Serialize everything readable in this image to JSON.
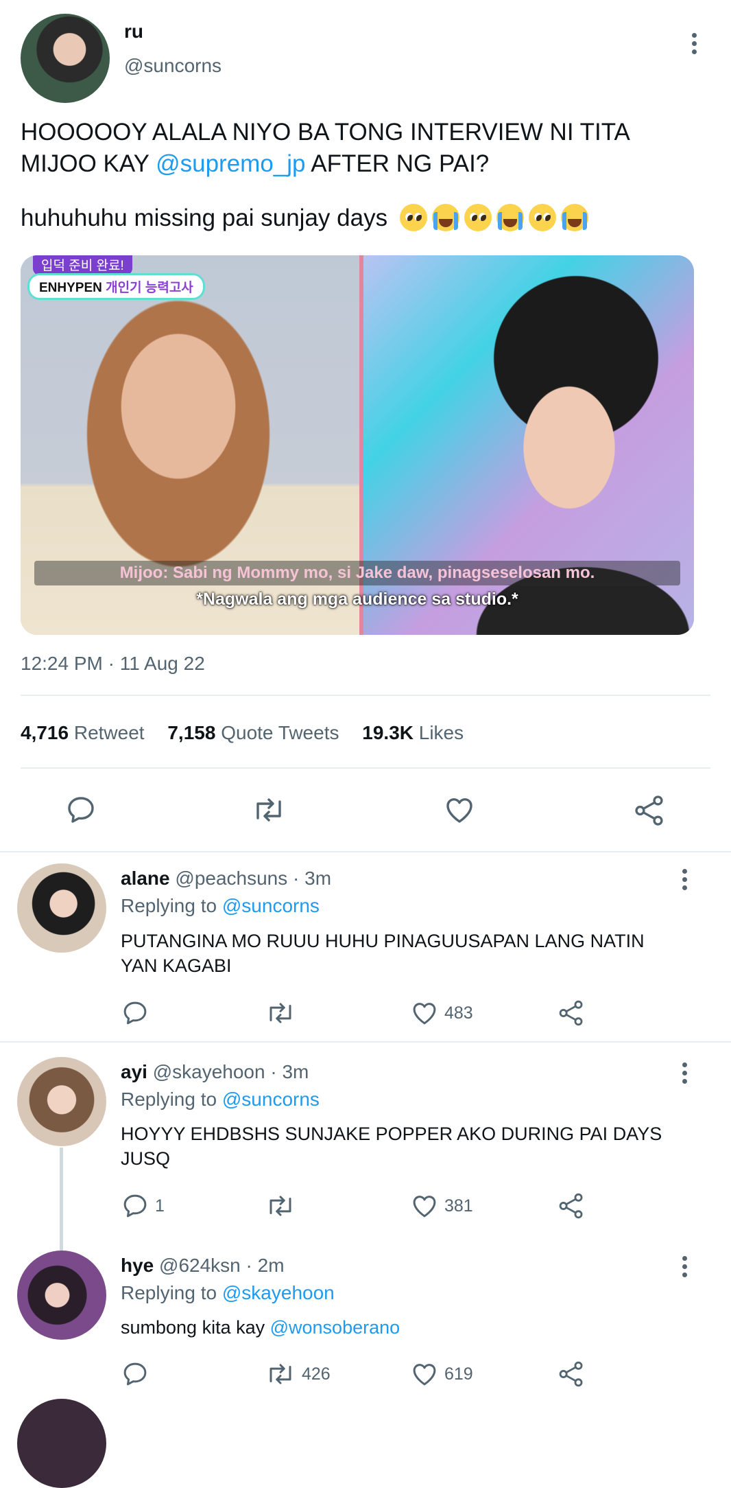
{
  "tweet": {
    "author_name": "ru",
    "author_handle": "@suncorns",
    "text_line1": "HOOOOOY ALALA NIYO BA TONG INTERVIEW NI TITA",
    "text_line2_pre": "MIJOO KAY ",
    "text_mention": "@supremo_jp",
    "text_line2_post": " AFTER NG PAI?",
    "text_second": "huhuhuhu missing pai sunjay days",
    "emojis": [
      "pleading-face",
      "crying-face",
      "pleading-face",
      "crying-face",
      "pleading-face",
      "crying-face"
    ],
    "media": {
      "badge_top": "입덕 준비 완료!",
      "badge_group": "ENHYPEN",
      "badge_rest": "개인기 능력고사",
      "caption1": "Mijoo: Sabi ng Mommy mo, si Jake daw, pinagseselosan mo.",
      "caption2": "*Nagwala ang mga audience sa studio.*"
    },
    "timestamp": "12:24 PM · 11 Aug 22",
    "stats": {
      "retweets": "4,716",
      "retweets_label": "Retweet",
      "quotes": "7,158",
      "quotes_label": "Quote Tweets",
      "likes": "19.3K",
      "likes_label": "Likes"
    }
  },
  "replies": [
    {
      "name": "alane",
      "handle": "@peachsuns",
      "time": "· 3m",
      "replying_label": "Replying to",
      "replying_to": "@suncorns",
      "text_line1": "PUTANGINA MO RUUU HUHU PINAGUUSAPAN LANG NATIN",
      "text_line2": "YAN KAGABI",
      "reply_count": "",
      "retweet_count": "",
      "like_count": "483"
    },
    {
      "name": "ayi",
      "handle": "@skayehoon",
      "time": "· 3m",
      "replying_label": "Replying to",
      "replying_to": "@suncorns",
      "text_line1": "HOYYY EHDBSHS SUNJAKE POPPER AKO DURING PAI DAYS",
      "text_line2": "JUSQ",
      "reply_count": "1",
      "retweet_count": "",
      "like_count": "381"
    },
    {
      "name": "hye",
      "handle": "@624ksn",
      "time": "· 2m",
      "replying_label": "Replying to",
      "replying_to": "@skayehoon",
      "text_pre": "sumbong kita kay ",
      "text_mention": "@wonsoberano",
      "reply_count": "",
      "retweet_count": "426",
      "like_count": "619"
    }
  ],
  "colors": {
    "link": "#1d9bf0",
    "muted": "#536471",
    "divider": "#e6ecf0"
  }
}
